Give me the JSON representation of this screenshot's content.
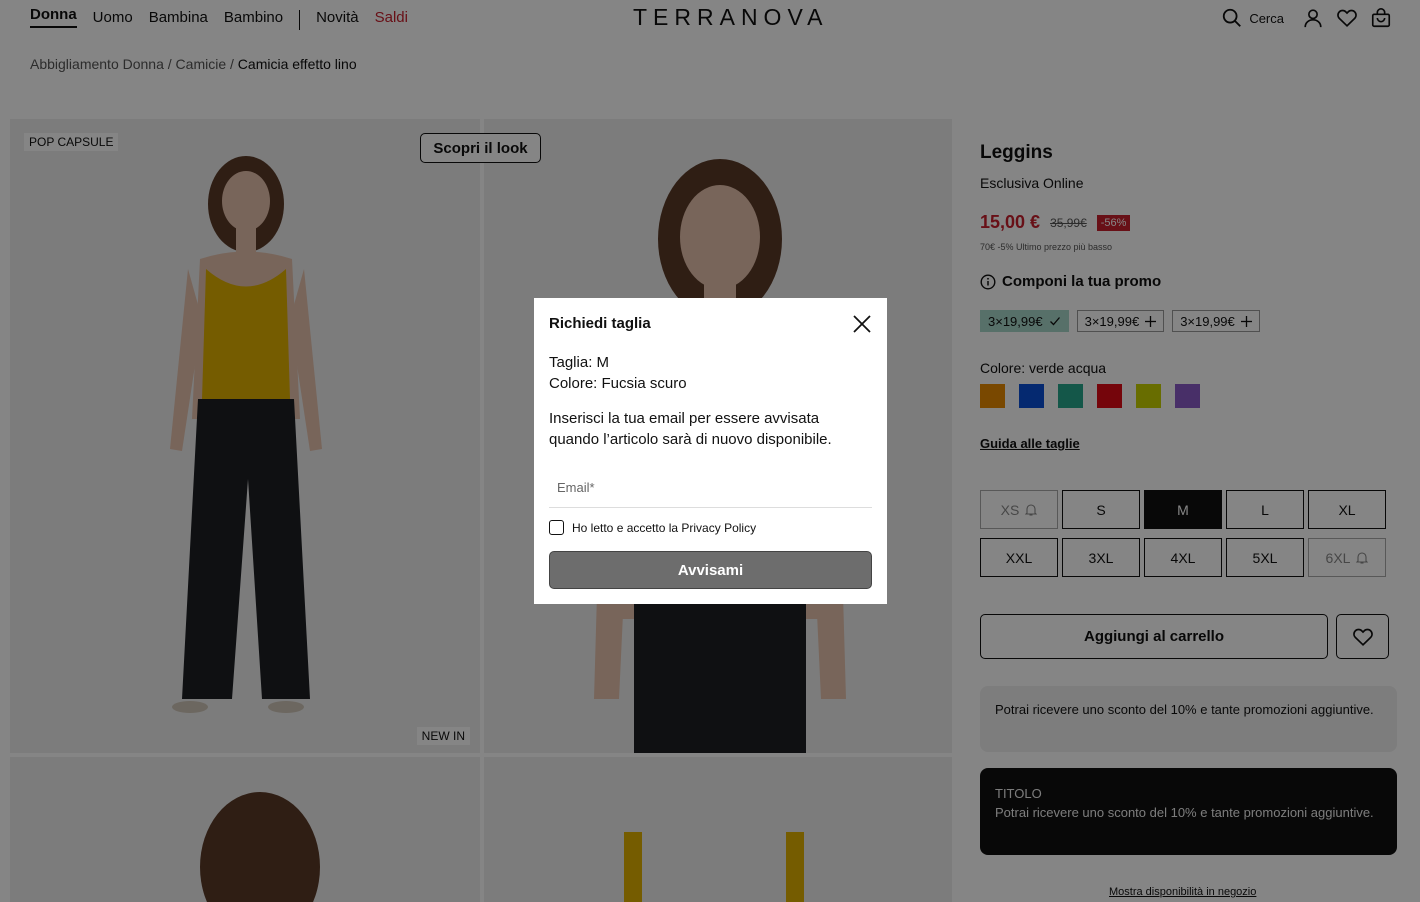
{
  "nav": {
    "items": [
      "Donna",
      "Uomo",
      "Bambina",
      "Bambino"
    ],
    "news": "Novità",
    "sale": "Saldi"
  },
  "logo": "TERRANOVA",
  "header": {
    "search_label": "Cerca"
  },
  "breadcrumb": {
    "items": [
      "Abbigliamento Donna",
      "Camicie"
    ],
    "current": "Camicia effetto lino",
    "separator": "/"
  },
  "gallery": {
    "pop_tag": "POP CAPSULE",
    "new_tag": "NEW IN",
    "look_button": "Scopri il look"
  },
  "product": {
    "title": "Leggins",
    "subtitle": "Esclusiva Online",
    "price": "15,00 €",
    "old_price": "35,99€",
    "discount": "-56%",
    "lowest_note": "70€ -5% Ultimo prezzo più basso",
    "promo_heading": "Componi la tua promo",
    "promos": [
      "3×19,99€",
      "3×19,99€",
      "3×19,99€"
    ],
    "color_label": "Colore: verde acqua",
    "swatches": [
      "#e88a00",
      "#0a4fd6",
      "#27a78d",
      "#e10a16",
      "#c8d200",
      "#8a5bc7"
    ],
    "size_guide": "Guida alle taglie",
    "sizes": [
      "XS",
      "S",
      "M",
      "L",
      "XL",
      "XXL",
      "3XL",
      "4XL",
      "5XL",
      "6XL"
    ],
    "add_to_cart": "Aggiungi al carrello",
    "info_text": "Potrai ricevere uno sconto del 10% e tante promozioni aggiuntive.",
    "dark_title": "TITOLO",
    "dark_text": "Potrai ricevere uno sconto del 10% e tante promozioni aggiuntive.",
    "store_link": "Mostra disponibilità in negozio"
  },
  "modal": {
    "title": "Richiedi taglia",
    "size_line": "Taglia: M",
    "color_line": "Colore: Fucsia scuro",
    "description": "Inserisci la tua email per essere avvisata quando l’articolo sarà di nuovo disponibile.",
    "email_placeholder": "Email*",
    "privacy_label": "Ho letto e accetto la Privacy Policy",
    "submit": "Avvisami"
  }
}
